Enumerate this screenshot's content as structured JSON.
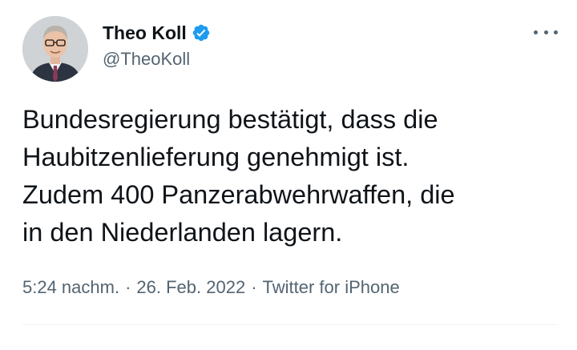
{
  "author": {
    "name": "Theo Koll",
    "handle": "@TheoKoll",
    "verified": true,
    "avatar_icon": "profile-photo"
  },
  "tweet": {
    "text": "Bundesregierung bestätigt, dass die\nHaubitzenlieferung genehmigt ist.\nZudem 400 Panzerabwehrwaffen, die\nin den Niederlanden lagern.",
    "time": "5:24 nachm.",
    "date": "26. Feb. 2022",
    "source": "Twitter for iPhone",
    "separator": "·"
  },
  "icons": {
    "verified": "verified-badge-icon",
    "more": "more-options-icon"
  },
  "colors": {
    "verified_blue": "#1d9bf0",
    "text_primary": "#0f1419",
    "text_secondary": "#536471",
    "divider": "#eff3f4"
  }
}
